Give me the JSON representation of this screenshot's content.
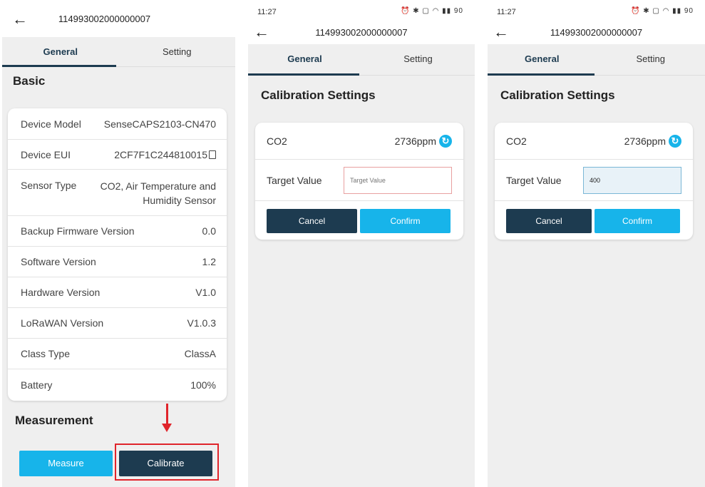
{
  "panel1": {
    "title": "114993002000000007",
    "tabs": [
      "General",
      "Setting"
    ],
    "section_basic": "Basic",
    "rows": [
      {
        "label": "Device Model",
        "value": "SenseCAPS2103-CN470"
      },
      {
        "label": "Device EUI",
        "value": "2CF7F1C244810015"
      },
      {
        "label": "Sensor Type",
        "value": "CO2, Air Temperature and Humidity Sensor"
      },
      {
        "label": "Backup Firmware Version",
        "value": "0.0"
      },
      {
        "label": "Software Version",
        "value": "1.2"
      },
      {
        "label": "Hardware Version",
        "value": "V1.0"
      },
      {
        "label": "LoRaWAN Version",
        "value": "V1.0.3"
      },
      {
        "label": "Class Type",
        "value": "ClassA"
      },
      {
        "label": "Battery",
        "value": "100%"
      }
    ],
    "section_measurement": "Measurement",
    "measure_label": "Measure",
    "calibrate_label": "Calibrate"
  },
  "panel2": {
    "time": "11:27",
    "status_icons": "⏰ ✱ ▢ ◠ ▮▮ 90",
    "title": "114993002000000007",
    "tabs": [
      "General",
      "Setting"
    ],
    "section_title": "Calibration Settings",
    "co2_label": "CO2",
    "co2_value": "2736ppm",
    "target_label": "Target Value",
    "target_placeholder": "Target Value",
    "target_value": "",
    "cancel_label": "Cancel",
    "confirm_label": "Confirm"
  },
  "panel3": {
    "time": "11:27",
    "status_icons": "⏰ ✱ ▢ ◠ ▮▮ 90",
    "title": "114993002000000007",
    "tabs": [
      "General",
      "Setting"
    ],
    "section_title": "Calibration Settings",
    "co2_label": "CO2",
    "co2_value": "2736ppm",
    "target_label": "Target Value",
    "target_value": "400",
    "cancel_label": "Cancel",
    "confirm_label": "Confirm"
  },
  "colors": {
    "primary_dark": "#1d3b50",
    "accent_blue": "#17b4ea",
    "highlight_red": "#e0242b"
  }
}
